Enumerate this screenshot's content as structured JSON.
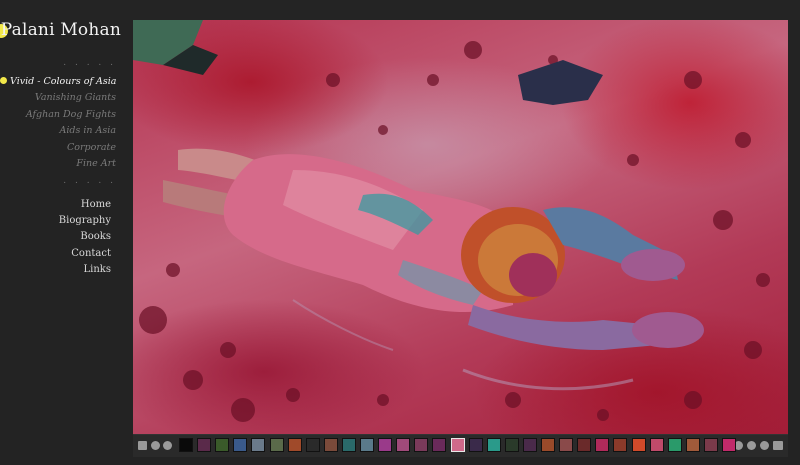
{
  "site": {
    "title": "Palani Mohan"
  },
  "separator": ". . . . .",
  "galleries": [
    {
      "label": "Vivid - Colours of Asia",
      "active": true
    },
    {
      "label": "Vanishing Giants",
      "active": false
    },
    {
      "label": "Afghan Dog Fights",
      "active": false
    },
    {
      "label": "Aids in Asia",
      "active": false
    },
    {
      "label": "Corporate",
      "active": false
    },
    {
      "label": "Fine Art",
      "active": false
    }
  ],
  "main_nav": [
    {
      "label": "Home"
    },
    {
      "label": "Biography"
    },
    {
      "label": "Books"
    },
    {
      "label": "Contact"
    },
    {
      "label": "Links"
    }
  ],
  "colors": {
    "accent": "#f2e84a",
    "background": "#232323",
    "active_text": "#f2f2f2",
    "inactive_text": "#7a7a7a"
  },
  "photo": {
    "subject": "person lying in red and pink Holi powder"
  },
  "filmstrip": {
    "left_controls": [
      "thumbnails-icon",
      "previous-icon",
      "next-icon"
    ],
    "right_controls": [
      "play-icon",
      "pause-icon",
      "info-icon",
      "fullscreen-icon"
    ],
    "selected_index": 15,
    "thumbnail_colors": [
      "#0a0a0a",
      "#5a2a4a",
      "#3a5a2a",
      "#3a5a8a",
      "#6a7a8a",
      "#5a6a4a",
      "#a04a2a",
      "#2a2a2a",
      "#7a4a3a",
      "#2a6a6a",
      "#5a7a8a",
      "#9a3a8a",
      "#a04a7a",
      "#7a3a5a",
      "#6a2a5a",
      "#d06a8a",
      "#3a2a4a",
      "#2a9a8a",
      "#2a3a2a",
      "#4a2a4a",
      "#9a4a2a",
      "#8a4a4a",
      "#6a2a2a",
      "#b02a5a",
      "#8a3a2a",
      "#d04a2a",
      "#c04a6a",
      "#2a9a6a",
      "#a05a3a",
      "#7a3a4a",
      "#c02a6a"
    ]
  }
}
